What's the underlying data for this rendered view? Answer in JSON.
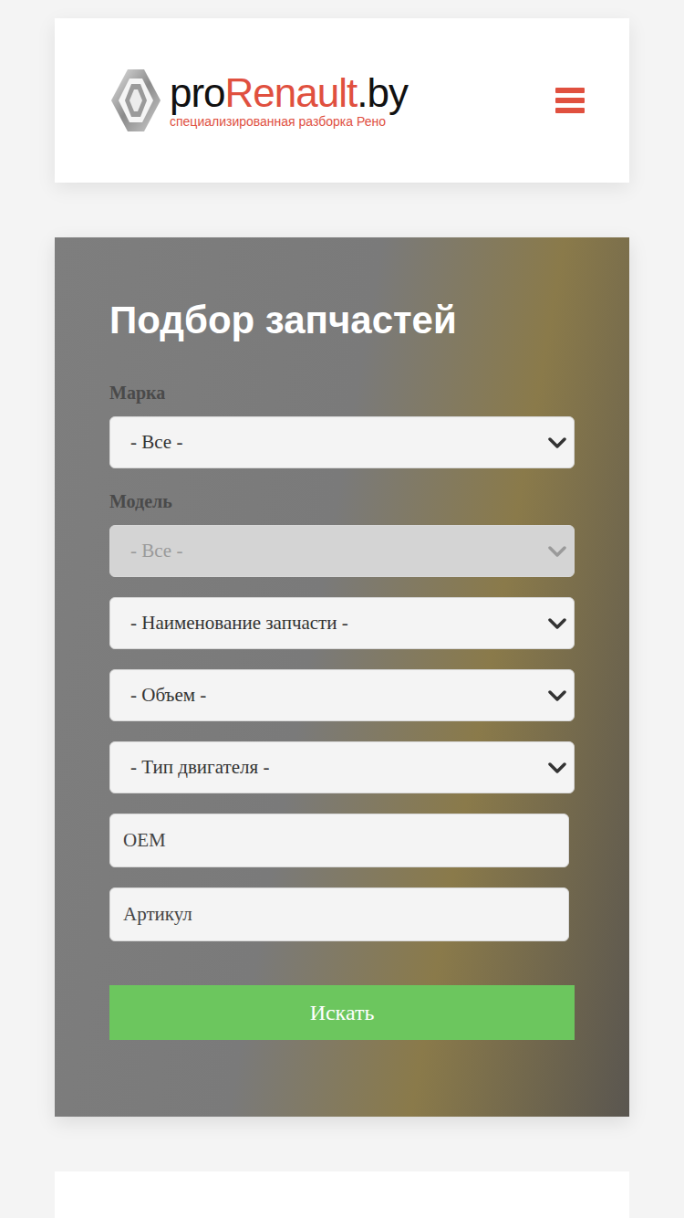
{
  "header": {
    "logo": {
      "prefix": "pro",
      "brand": "Renault",
      "suffix": ".by",
      "tagline": "специализированная разборка Рено"
    }
  },
  "search_form": {
    "title": "Подбор запчастей",
    "fields": [
      {
        "kind": "select",
        "label": "Марка",
        "value": "- Все -",
        "disabled": false
      },
      {
        "kind": "select",
        "label": "Модель",
        "value": "- Все -",
        "disabled": true
      },
      {
        "kind": "select",
        "label": "",
        "value": "- Наименование запчасти -",
        "disabled": false
      },
      {
        "kind": "select",
        "label": "",
        "value": "- Объем -",
        "disabled": false
      },
      {
        "kind": "select",
        "label": "",
        "value": "- Тип двигателя -",
        "disabled": false
      },
      {
        "kind": "input",
        "label": "",
        "value": "OEM",
        "disabled": false
      },
      {
        "kind": "input",
        "label": "",
        "value": "Артикул",
        "disabled": false
      }
    ],
    "button": "Искать"
  }
}
